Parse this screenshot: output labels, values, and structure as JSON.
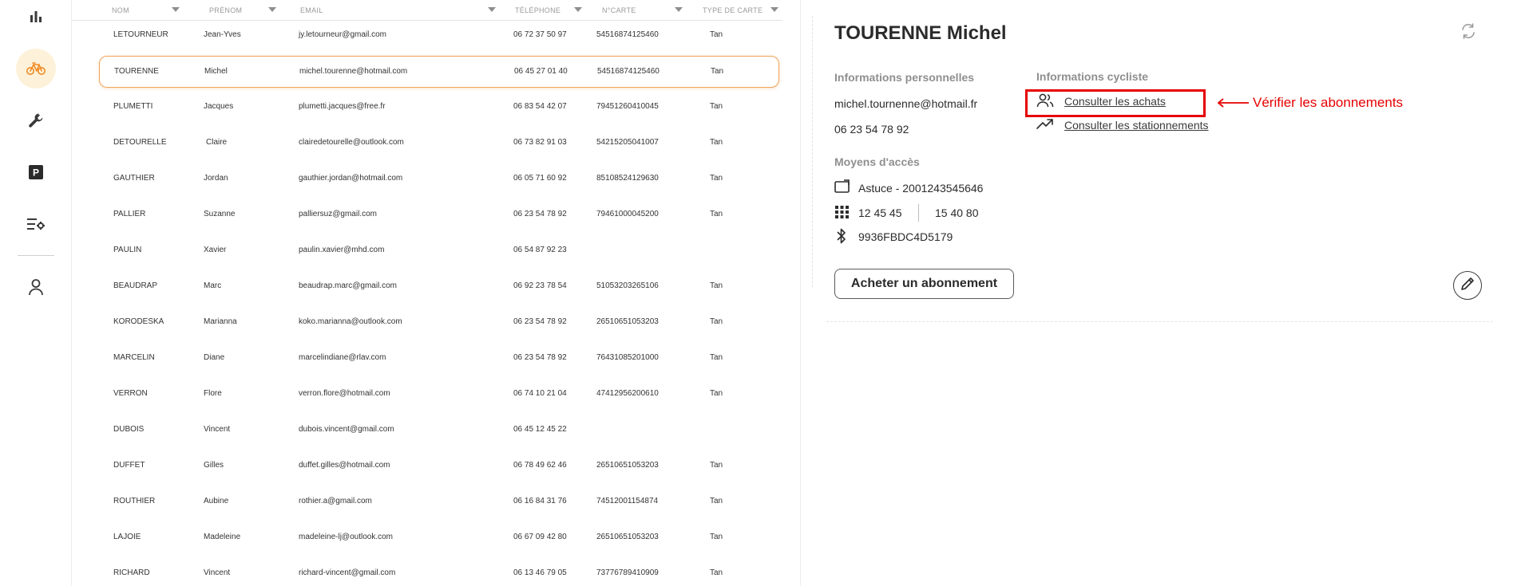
{
  "sidebar": {
    "items": [
      {
        "icon": "bar-chart-icon"
      },
      {
        "icon": "bicycle-icon",
        "active": true
      },
      {
        "icon": "wrench-icon"
      },
      {
        "icon": "parking-icon",
        "glyph": "P"
      },
      {
        "icon": "list-settings-icon"
      },
      {
        "icon": "user-icon"
      }
    ],
    "active_color": "#f08a24"
  },
  "table": {
    "columns": [
      "NOM",
      "PRÉNOM",
      "EMAIL",
      "TÉLÉPHONE",
      "N°CARTE",
      "TYPE DE CARTE"
    ],
    "rows": [
      {
        "nom": "LETOURNEUR",
        "prenom": "Jean-Yves",
        "email": "jy.letourneur@gmail.com",
        "telephone": "06 72 37 50 97",
        "carte": "54516874125460",
        "type": "Tan"
      },
      {
        "nom": "TOURENNE",
        "prenom": "Michel",
        "email": "michel.tourenne@hotmail.com",
        "telephone": "06 45 27 01 40",
        "carte": "54516874125460",
        "type": "Tan",
        "selected": true
      },
      {
        "nom": "PLUMETTI",
        "prenom": "Jacques",
        "email": "plumetti.jacques@free.fr",
        "telephone": "06 83 54 42 07",
        "carte": "79451260410045",
        "type": "Tan"
      },
      {
        "nom": "DETOURELLE",
        "prenom": "Claire",
        "email": "clairedetourelle@outlook.com",
        "telephone": "06 73 82 91 03",
        "carte": "54215205041007",
        "type": "Tan"
      },
      {
        "nom": "GAUTHIER",
        "prenom": "Jordan",
        "email": "gauthier.jordan@hotmail.com",
        "telephone": "06 05 71 60 92",
        "carte": "85108524129630",
        "type": "Tan"
      },
      {
        "nom": "PALLIER",
        "prenom": "Suzanne",
        "email": "palliersuz@gmail.com",
        "telephone": "06 23 54 78 92",
        "carte": "79461000045200",
        "type": "Tan"
      },
      {
        "nom": "PAULIN",
        "prenom": "Xavier",
        "email": "paulin.xavier@mhd.com",
        "telephone": "06 54 87 92 23",
        "carte": "",
        "type": ""
      },
      {
        "nom": "BEAUDRAP",
        "prenom": "Marc",
        "email": "beaudrap.marc@gmail.com",
        "telephone": "06 92 23 78 54",
        "carte": "51053203265106",
        "type": "Tan"
      },
      {
        "nom": "KORODESKA",
        "prenom": "Marianna",
        "email": "koko.marianna@outlook.com",
        "telephone": "06 23 54 78 92",
        "carte": "26510651053203",
        "type": "Tan"
      },
      {
        "nom": "MARCELIN",
        "prenom": "Diane",
        "email": "marcelindiane@rlav.com",
        "telephone": "06 23 54 78 92",
        "carte": "76431085201000",
        "type": "Tan"
      },
      {
        "nom": "VERRON",
        "prenom": "Flore",
        "email": "verron.flore@hotmail.com",
        "telephone": "06 74 10 21 04",
        "carte": "47412956200610",
        "type": "Tan"
      },
      {
        "nom": "DUBOIS",
        "prenom": "Vincent",
        "email": "dubois.vincent@gmail.com",
        "telephone": "06 45 12 45 22",
        "carte": "",
        "type": ""
      },
      {
        "nom": "DUFFET",
        "prenom": "Gilles",
        "email": "duffet.gilles@hotmail.com",
        "telephone": "06 78 49 62 46",
        "carte": "26510651053203",
        "type": "Tan"
      },
      {
        "nom": "ROUTHIER",
        "prenom": "Aubine",
        "email": "rothier.a@gmail.com",
        "telephone": "06 16 84 31 76",
        "carte": "74512001154874",
        "type": "Tan"
      },
      {
        "nom": "LAJOIE",
        "prenom": "Madeleine",
        "email": "madeleine-lj@outlook.com",
        "telephone": "06 67 09 42 80",
        "carte": "26510651053203",
        "type": "Tan"
      },
      {
        "nom": "RICHARD",
        "prenom": "Vincent",
        "email": "richard-vincent@gmail.com",
        "telephone": "06 13 46 79 05",
        "carte": "73776789410909",
        "type": "Tan"
      }
    ]
  },
  "detail": {
    "title": "TOURENNE Michel",
    "personal": {
      "label": "Informations personnelles",
      "email": "michel.tournenne@hotmail.fr",
      "phone": "06 23 54 78 92"
    },
    "access": {
      "label": "Moyens d'accès",
      "card": "Astuce - 2001243545646",
      "code_1": "12 45 45",
      "code_2": "15 40 80",
      "bluetooth": "9936FBDC4D5179"
    },
    "cyclist": {
      "label": "Informations cycliste",
      "purchases_link": "Consulter les achats",
      "parkings_link": "Consulter les stationnements"
    },
    "buy_button": "Acheter un abonnement",
    "annotation": "Vérifier les abonnements",
    "annotation_color": "#e60000"
  }
}
